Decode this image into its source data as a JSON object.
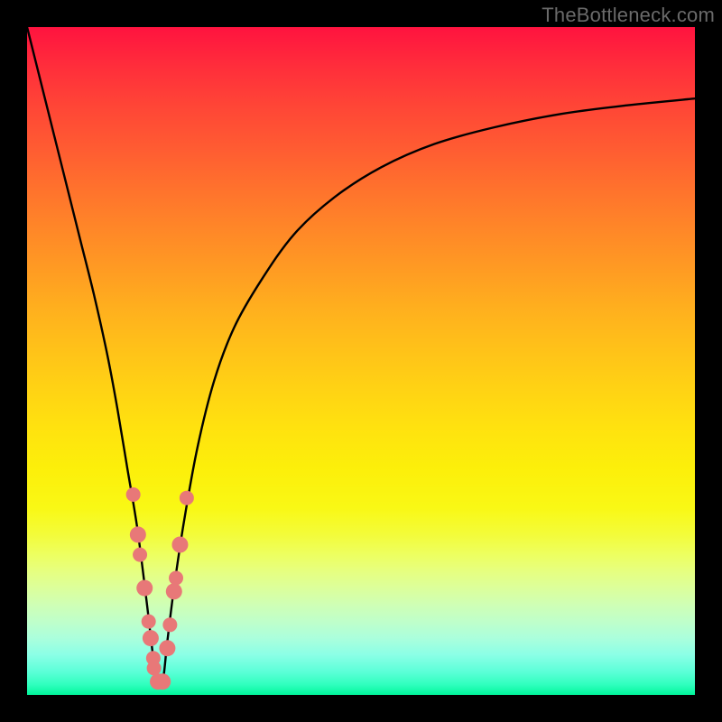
{
  "watermark": {
    "text": "TheBottleneck.com"
  },
  "chart_data": {
    "type": "line",
    "title": "",
    "xlabel": "",
    "ylabel": "",
    "xlim": [
      0,
      100
    ],
    "ylim": [
      0,
      100
    ],
    "series": [
      {
        "name": "bottleneck-curve",
        "x": [
          0,
          2,
          4,
          6,
          8,
          10,
          12,
          13.5,
          15,
          16.5,
          17.9,
          18.6,
          19.4,
          20.3,
          21,
          22,
          23.5,
          25.5,
          28,
          31,
          35,
          40,
          46,
          53,
          61,
          70,
          80,
          90,
          100
        ],
        "values": [
          100,
          92,
          84,
          76,
          68,
          60,
          51,
          43,
          34,
          25,
          14,
          8,
          2,
          2,
          8,
          16,
          26,
          37,
          47,
          55,
          62,
          69,
          74.5,
          79,
          82.5,
          85,
          87,
          88.3,
          89.3
        ]
      }
    ],
    "markers": {
      "name": "highlighted-points",
      "color": "#e87878",
      "points": [
        {
          "x": 15.9,
          "y": 30.0,
          "r": 8
        },
        {
          "x": 16.6,
          "y": 24.0,
          "r": 9
        },
        {
          "x": 16.9,
          "y": 21.0,
          "r": 8
        },
        {
          "x": 17.6,
          "y": 16.0,
          "r": 9
        },
        {
          "x": 18.2,
          "y": 11.0,
          "r": 8
        },
        {
          "x": 18.5,
          "y": 8.5,
          "r": 9
        },
        {
          "x": 18.9,
          "y": 5.5,
          "r": 8
        },
        {
          "x": 19.0,
          "y": 4.0,
          "r": 8
        },
        {
          "x": 19.6,
          "y": 2.0,
          "r": 9
        },
        {
          "x": 20.3,
          "y": 2.0,
          "r": 9
        },
        {
          "x": 21.0,
          "y": 7.0,
          "r": 9
        },
        {
          "x": 21.4,
          "y": 10.5,
          "r": 8
        },
        {
          "x": 22.0,
          "y": 15.5,
          "r": 9
        },
        {
          "x": 22.3,
          "y": 17.5,
          "r": 8
        },
        {
          "x": 22.9,
          "y": 22.5,
          "r": 9
        },
        {
          "x": 23.9,
          "y": 29.5,
          "r": 8
        }
      ]
    },
    "gradient_stops": [
      {
        "pos": 0.0,
        "color": "#ff133f"
      },
      {
        "pos": 0.5,
        "color": "#ffd214"
      },
      {
        "pos": 0.82,
        "color": "#e6ff80"
      },
      {
        "pos": 1.0,
        "color": "#00f59a"
      }
    ]
  }
}
